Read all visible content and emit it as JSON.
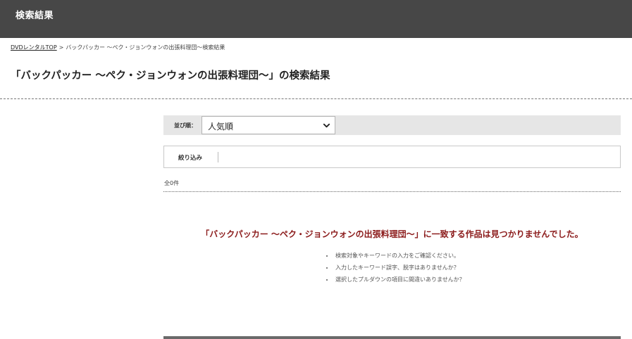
{
  "header": {
    "title": "検索結果"
  },
  "breadcrumb": {
    "home": "DVDレンタルTOP",
    "separator": ">",
    "current": "バックパッカー ～ペク・ジョンウォンの出張料理団～検索結果"
  },
  "page_title": "「バックパッカー ～ペク・ジョンウォンの出張料理団～」の検索結果",
  "sort": {
    "label": "並び順：",
    "selected": "人気順",
    "chevron_icon": "chevron-down-icon"
  },
  "filter": {
    "label": "絞り込み"
  },
  "result_count": "全0件",
  "message": {
    "not_found": "「バックパッカー ～ペク・ジョンウォンの出張料理団～」に一致する作品は見つかりませんでした。",
    "color": "#8b1a1a",
    "tips": [
      "検索対象やキーワードの入力をご確認ください。",
      "入力したキーワード誤字、脱字はありませんか？",
      "選択したプルダウンの項目に間違いありませんか？"
    ]
  },
  "colors": {
    "header_bg": "#474747",
    "sort_bar_bg": "#e6e6e6"
  }
}
